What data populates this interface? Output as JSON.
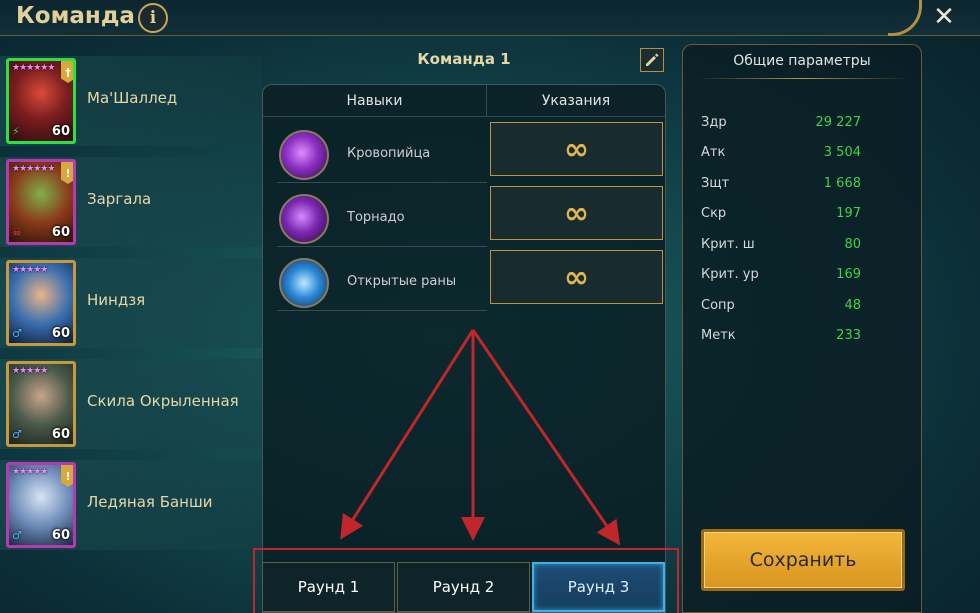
{
  "header": {
    "title": "Команда",
    "info_icon": "info-icon",
    "close_icon": "close-icon",
    "close_glyph": "✕",
    "info_glyph": "i"
  },
  "heroes": [
    {
      "name": "Ма'Шаллед",
      "level": "60",
      "stars": "★★★★★★",
      "rarity": "legendary",
      "selected": true,
      "badge": "†"
    },
    {
      "name": "Заргала",
      "level": "60",
      "stars": "★★★★★★",
      "rarity": "epic",
      "selected": false,
      "badge": "!"
    },
    {
      "name": "Ниндзя",
      "level": "60",
      "stars": "★★★★★",
      "rarity": "legendary",
      "selected": false,
      "badge": ""
    },
    {
      "name": "Скила Окрыленная",
      "level": "60",
      "stars": "★★★★★",
      "rarity": "legendary",
      "selected": false,
      "badge": ""
    },
    {
      "name": "Ледяная Банши",
      "level": "60",
      "stars": "★★★★★",
      "rarity": "epic",
      "selected": false,
      "badge": "!"
    }
  ],
  "team": {
    "title": "Команда 1",
    "edit_icon": "pencil-icon",
    "columns": {
      "skills": "Навыки",
      "instructions": "Указания"
    },
    "skills": [
      {
        "name": "Кровопийца",
        "instruction": "∞"
      },
      {
        "name": "Торнадо",
        "instruction": "∞"
      },
      {
        "name": "Открытые раны",
        "instruction": "∞"
      }
    ],
    "rounds": [
      "Раунд 1",
      "Раунд 2",
      "Раунд 3"
    ],
    "active_round": "Раунд 3"
  },
  "params": {
    "title": "Общие параметры",
    "stats": [
      {
        "label": "Здр",
        "value": "29 227"
      },
      {
        "label": "Атк",
        "value": "3 504"
      },
      {
        "label": "Зщт",
        "value": "1 668"
      },
      {
        "label": "Скр",
        "value": "197"
      },
      {
        "label": "Крит. ш",
        "value": "80"
      },
      {
        "label": "Крит. ур",
        "value": "169"
      },
      {
        "label": "Сопр",
        "value": "48"
      },
      {
        "label": "Метк",
        "value": "233"
      }
    ],
    "save_label": "Сохранить"
  },
  "colors": {
    "accent_gold": "#c69a3c",
    "stat_green": "#3fd24a",
    "annotation_red": "#c0262a",
    "active_tab_blue": "#3fb0e8"
  }
}
